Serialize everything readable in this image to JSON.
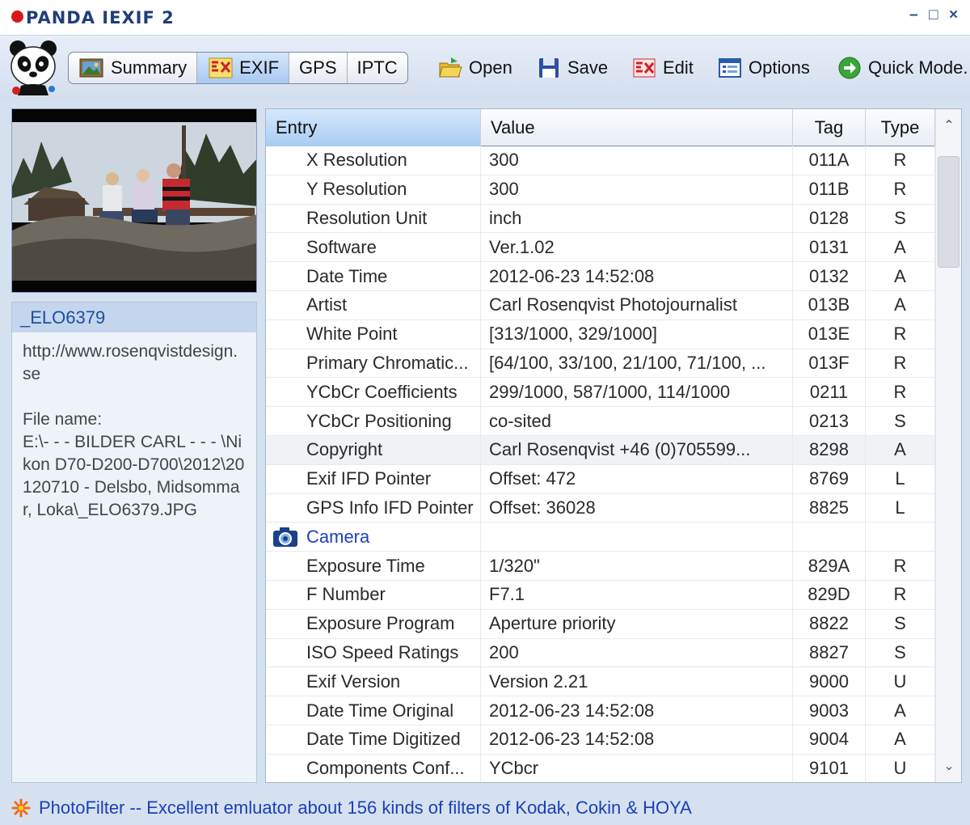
{
  "window": {
    "title": "PANDA IEXIF 2",
    "controls": {
      "minimize": "–",
      "maximize": "□",
      "close": "×"
    }
  },
  "toolbar": {
    "tabs": [
      {
        "label": "Summary",
        "icon": "summary-photo-icon",
        "active": false
      },
      {
        "label": "EXIF",
        "icon": "exif-icon",
        "active": true
      },
      {
        "label": "GPS",
        "icon": "",
        "active": false
      },
      {
        "label": "IPTC",
        "icon": "",
        "active": false
      }
    ],
    "actions": [
      {
        "label": "Open",
        "icon": "open-folder-icon"
      },
      {
        "label": "Save",
        "icon": "floppy-save-icon"
      },
      {
        "label": "Edit",
        "icon": "edit-icon"
      },
      {
        "label": "Options",
        "icon": "options-window-icon"
      },
      {
        "label": "Quick Mode.",
        "icon": "green-arrow-icon"
      }
    ]
  },
  "sidebar": {
    "file_title": "_ELO6379",
    "url": "http://www.rosenqvistdesign.se",
    "file_label": "File name:",
    "file_path": "E:\\- - - BILDER CARL - - - \\Nikon D70-D200-D700\\2012\\20120710 - Delsbo, Midsommar, Loka\\_ELO6379.JPG"
  },
  "table": {
    "columns": [
      "Entry",
      "Value",
      "Tag",
      "Type"
    ],
    "rows": [
      {
        "entry": "X Resolution",
        "value": "300",
        "tag": "011A",
        "type": "R"
      },
      {
        "entry": "Y Resolution",
        "value": "300",
        "tag": "011B",
        "type": "R"
      },
      {
        "entry": "Resolution Unit",
        "value": "inch",
        "tag": "0128",
        "type": "S"
      },
      {
        "entry": "Software",
        "value": "Ver.1.02",
        "tag": "0131",
        "type": "A"
      },
      {
        "entry": "Date Time",
        "value": "2012-06-23 14:52:08",
        "tag": "0132",
        "type": "A"
      },
      {
        "entry": "Artist",
        "value": "Carl Rosenqvist  Photojournalist",
        "tag": "013B",
        "type": "A"
      },
      {
        "entry": "White Point",
        "value": "[313/1000, 329/1000]",
        "tag": "013E",
        "type": "R"
      },
      {
        "entry": "Primary Chromatic...",
        "value": "[64/100, 33/100, 21/100, 71/100, ...",
        "tag": "013F",
        "type": "R"
      },
      {
        "entry": "YCbCr Coefficients",
        "value": "299/1000, 587/1000, 114/1000",
        "tag": "0211",
        "type": "R"
      },
      {
        "entry": "YCbCr Positioning",
        "value": "co-sited",
        "tag": "0213",
        "type": "S"
      },
      {
        "entry": "Copyright",
        "value": "Carl Rosenqvist  +46 (0)705599...",
        "tag": "8298",
        "type": "A",
        "selected": true
      },
      {
        "entry": "Exif IFD Pointer",
        "value": "Offset: 472",
        "tag": "8769",
        "type": "L"
      },
      {
        "entry": "GPS Info IFD Pointer",
        "value": "Offset: 36028",
        "tag": "8825",
        "type": "L"
      },
      {
        "entry": "Camera",
        "value": "",
        "tag": "",
        "type": "",
        "section": true,
        "icon": "camera-icon"
      },
      {
        "entry": "Exposure Time",
        "value": "1/320\"",
        "tag": "829A",
        "type": "R"
      },
      {
        "entry": "F Number",
        "value": "F7.1",
        "tag": "829D",
        "type": "R"
      },
      {
        "entry": "Exposure Program",
        "value": "Aperture priority",
        "tag": "8822",
        "type": "S"
      },
      {
        "entry": "ISO Speed Ratings",
        "value": "200",
        "tag": "8827",
        "type": "S"
      },
      {
        "entry": "Exif Version",
        "value": "Version 2.21",
        "tag": "9000",
        "type": "U"
      },
      {
        "entry": "Date Time Original",
        "value": "2012-06-23 14:52:08",
        "tag": "9003",
        "type": "A"
      },
      {
        "entry": "Date Time Digitized",
        "value": "2012-06-23 14:52:08",
        "tag": "9004",
        "type": "A"
      },
      {
        "entry": "Components Conf...",
        "value": "YCbcr",
        "tag": "9101",
        "type": "U"
      }
    ]
  },
  "status": {
    "message": "PhotoFilter -- Excellent emluator about 156 kinds of filters of Kodak, Cokin & HOYA",
    "icon": "sparkle-icon"
  },
  "colors": {
    "accent": "#1e4f9a",
    "link": "#1b3fb8",
    "section": "#2040c0",
    "title_dot": "#d41a1a"
  }
}
